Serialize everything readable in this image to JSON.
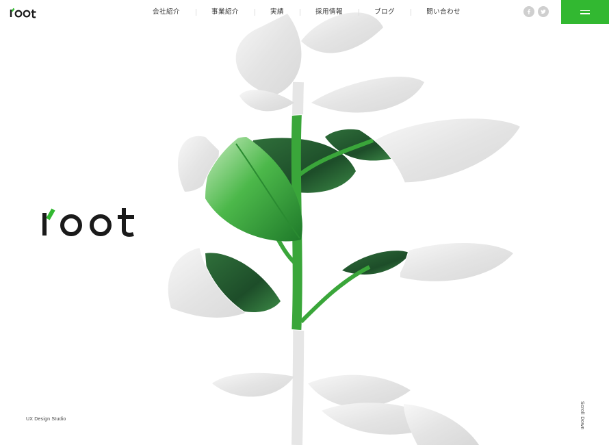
{
  "brand": {
    "header_logo_text": "root",
    "hero_logo_text": "root",
    "accent_color": "#32b831",
    "text_color": "#1a1a1a"
  },
  "nav": {
    "items": [
      {
        "label": "会社紹介"
      },
      {
        "label": "事業紹介"
      },
      {
        "label": "実績"
      },
      {
        "label": "採用情報"
      },
      {
        "label": "ブログ"
      },
      {
        "label": "問い合わせ"
      }
    ]
  },
  "social": {
    "facebook_icon": "facebook-icon",
    "twitter_icon": "twitter-icon"
  },
  "menu_button": {
    "icon": "hamburger-icon"
  },
  "hero": {
    "tagline": "UX Design Studio",
    "scroll_label": "Scroll Down",
    "image": "rubber plant, greyscale with green circular spotlight"
  }
}
